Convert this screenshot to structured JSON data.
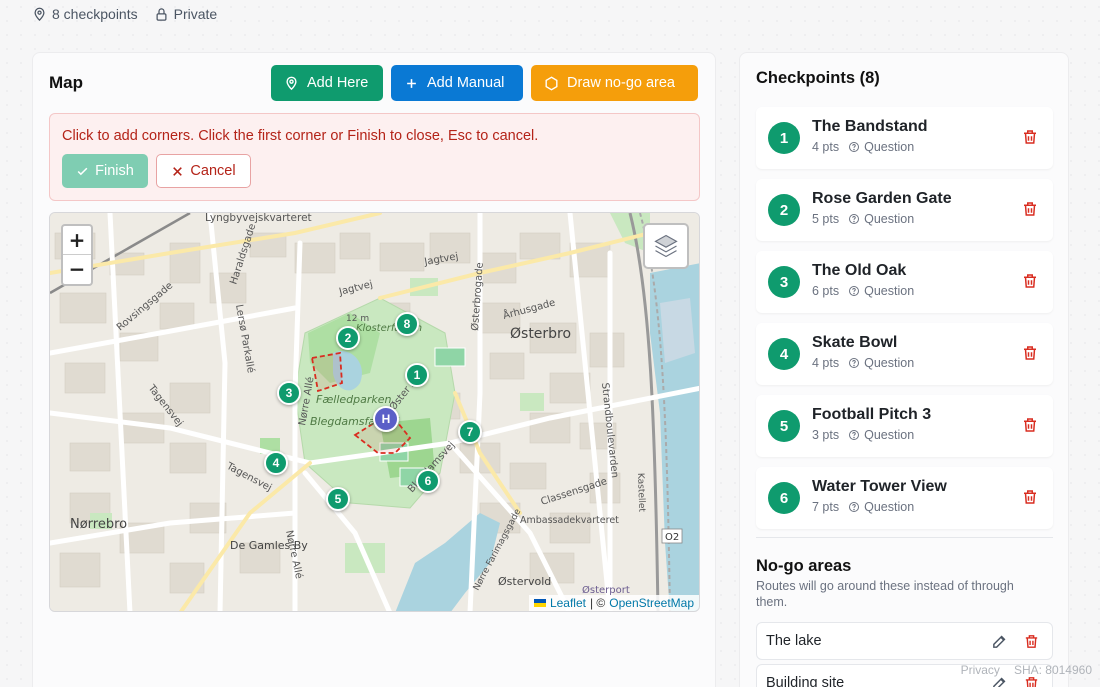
{
  "meta": {
    "checkpoints": "8 checkpoints",
    "visibility": "Private"
  },
  "map_panel": {
    "title": "Map",
    "buttons": {
      "add_here": "Add Here",
      "add_manual": "Add Manual",
      "draw_nogo": "Draw no-go area"
    },
    "alert": {
      "text": "Click to add corners. Click the first corner or Finish to close, Esc to cancel.",
      "finish": "Finish",
      "cancel": "Cancel"
    },
    "map": {
      "zoom_in": "+",
      "zoom_out": "−",
      "attribution_leaflet": "Leaflet",
      "attribution_sep": "| ©",
      "attribution_osm": "OpenStreetMap",
      "labels": [
        "Lyngbyvejskvarteret",
        "Jagtvej",
        "Haraldsgade",
        "Rovsingsgade",
        "Lersø Parkallé",
        "Tagensvej",
        "Nørre Allé",
        "Fælledparken",
        "Blegdamsfælled",
        "Østerbro",
        "Århusgade",
        "Østerbrogade",
        "Øster Allé",
        "Strandboulevarden",
        "Classensgade",
        "Ambassadekvarteret",
        "Nørrebro",
        "De Gamles By",
        "Østervold",
        "Østerport",
        "Kastellet",
        "Klosterfalden",
        "12 m",
        "O2",
        "Blegdamsvej",
        "Nørre Farimagsgade"
      ],
      "markers": [
        "1",
        "2",
        "3",
        "4",
        "5",
        "6",
        "7",
        "8"
      ],
      "home_marker": "H"
    }
  },
  "checkpoints_panel": {
    "title": "Checkpoints (8)",
    "items": [
      {
        "num": "1",
        "name": "The Bandstand",
        "pts": "4 pts",
        "type": "Question"
      },
      {
        "num": "2",
        "name": "Rose Garden Gate",
        "pts": "5 pts",
        "type": "Question"
      },
      {
        "num": "3",
        "name": "The Old Oak",
        "pts": "6 pts",
        "type": "Question"
      },
      {
        "num": "4",
        "name": "Skate Bowl",
        "pts": "4 pts",
        "type": "Question"
      },
      {
        "num": "5",
        "name": "Football Pitch 3",
        "pts": "3 pts",
        "type": "Question"
      },
      {
        "num": "6",
        "name": "Water Tower View",
        "pts": "7 pts",
        "type": "Question"
      }
    ],
    "nogo_title": "No-go areas",
    "nogo_desc": "Routes will go around these instead of through them.",
    "nogo_items": [
      {
        "name": "The lake"
      },
      {
        "name": "Building site"
      }
    ]
  },
  "footer": {
    "privacy": "Privacy",
    "sha": "SHA: 8014960"
  },
  "colors": {
    "green": "#0f9b6e",
    "blue": "#0a79d4",
    "orange": "#f59e0b",
    "danger": "#b42318",
    "home_marker": "#5b5fc7"
  }
}
